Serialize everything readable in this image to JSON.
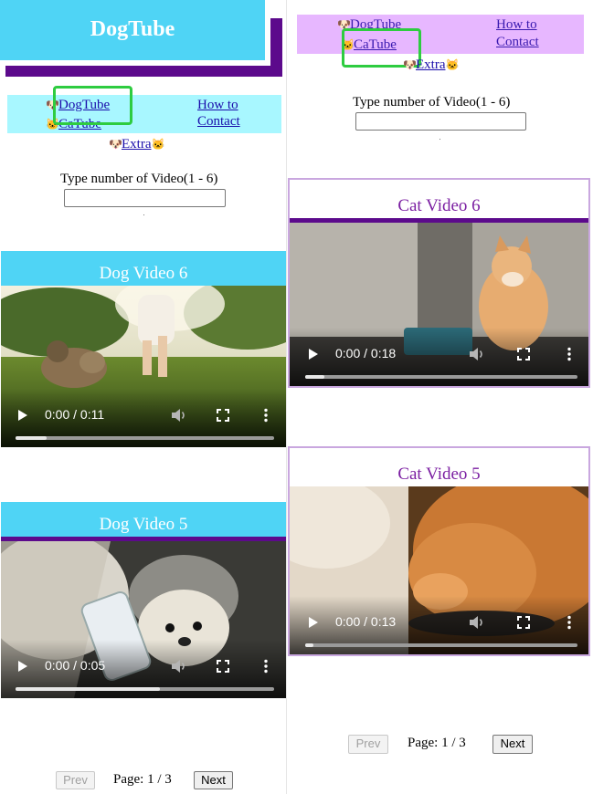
{
  "left": {
    "logo": "DogTube",
    "nav": {
      "dogtube": "DogTube",
      "catube": "CaTube",
      "howto": "How to",
      "contact": "Contact",
      "extra": "Extra",
      "emoji_dog": "🐶",
      "emoji_cat": "🐱"
    },
    "prompt": "Type number of Video(1 - 6)",
    "input_value": "",
    "videos": [
      {
        "title": "Dog Video 6",
        "time": "0:00 / 0:11",
        "progress": 0.12
      },
      {
        "title": "Dog Video 5",
        "time": "0:00 / 0:05",
        "progress": 0.56
      }
    ],
    "pagination": {
      "prev": "Prev",
      "page_label": "Page:",
      "page_current": "1",
      "page_sep": "/",
      "page_total": "3",
      "next": "Next"
    }
  },
  "right": {
    "nav": {
      "dogtube": "DogTube",
      "catube": "CaTube",
      "howto": "How to",
      "contact": "Contact",
      "extra": "Extra",
      "emoji_dog": "🐶",
      "emoji_cat": "🐱"
    },
    "prompt": "Type number of Video(1 - 6)",
    "input_value": "",
    "videos": [
      {
        "title": "Cat Video 6",
        "time": "0:00 / 0:18",
        "progress": 0.07
      },
      {
        "title": "Cat Video 5",
        "time": "0:00 / 0:13",
        "progress": 0.03
      }
    ],
    "pagination": {
      "prev": "Prev",
      "page_label": "Page:",
      "page_current": "1",
      "page_sep": "/",
      "page_total": "3",
      "next": "Next"
    }
  },
  "colors": {
    "dog_header": "#4fd4f5",
    "accent_purple": "#5c0a8c",
    "cat_nav_bg": "#e7b7ff",
    "dog_nav_bg": "#a8f7ff",
    "highlight": "#2ecc40",
    "cat_title": "#7b1fa2"
  },
  "icons": [
    "play-icon",
    "volume-icon",
    "fullscreen-icon",
    "more-options-icon",
    "dog-emoji-icon",
    "cat-emoji-icon"
  ]
}
